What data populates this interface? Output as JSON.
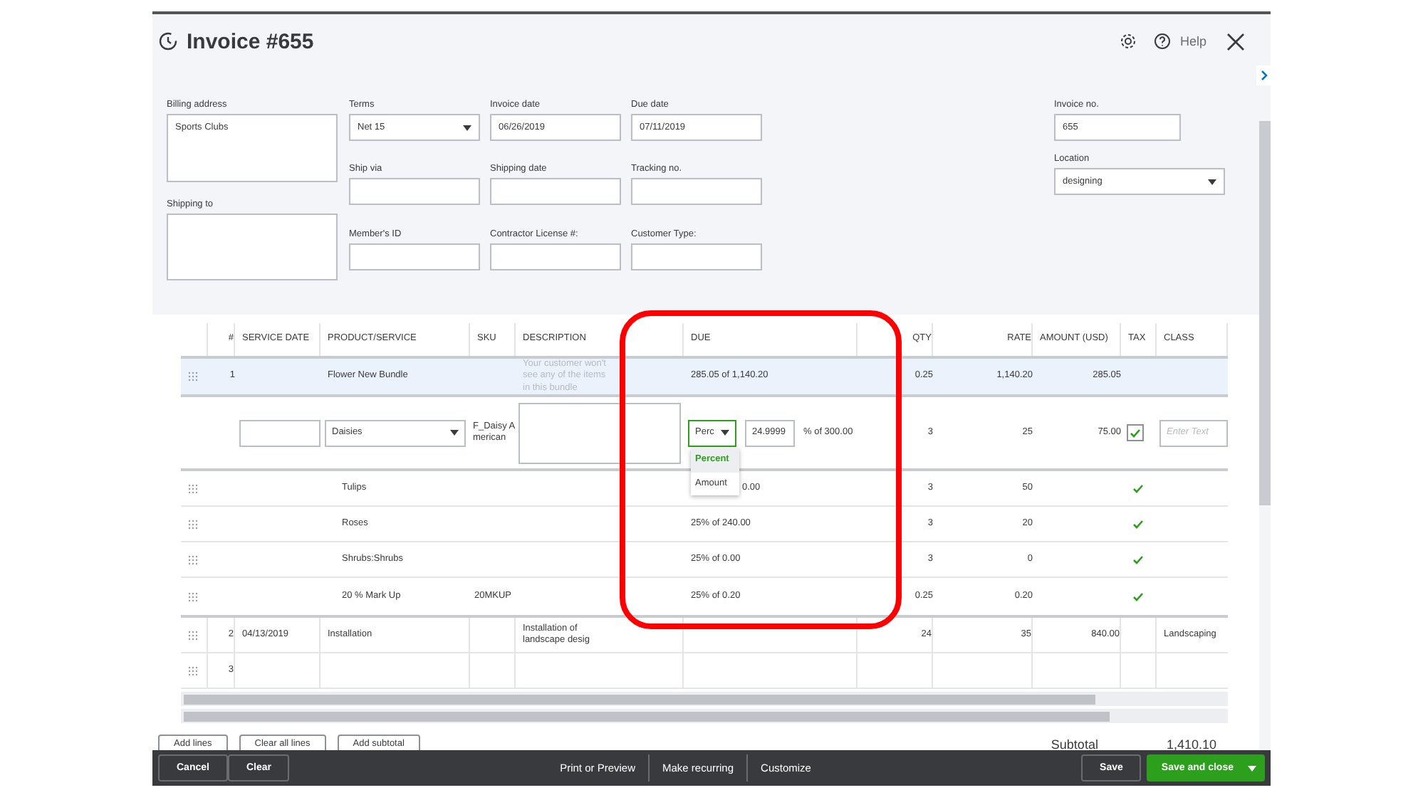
{
  "window": {
    "title": "Invoice #655",
    "help": "Help"
  },
  "form": {
    "billing_address": {
      "label": "Billing address",
      "value": "Sports Clubs"
    },
    "shipping_to": {
      "label": "Shipping to"
    },
    "fields": [
      {
        "label": "Terms",
        "value": "Net 15",
        "kind": "select"
      },
      {
        "label": "Invoice date",
        "value": "06/26/2019",
        "kind": "text"
      },
      {
        "label": "Due date",
        "value": "07/11/2019",
        "kind": "text"
      },
      {
        "label": "Ship via",
        "kind": "text"
      },
      {
        "label": "Shipping date",
        "kind": "text"
      },
      {
        "label": "Tracking no.",
        "kind": "text"
      },
      {
        "label": "Member's ID",
        "kind": "text"
      },
      {
        "label": "Contractor License #:",
        "kind": "text"
      },
      {
        "label": "Customer Type:",
        "kind": "text"
      }
    ],
    "right_fields": [
      {
        "label": "Invoice no.",
        "value": "655",
        "kind": "text"
      },
      {
        "label": "Location",
        "value": "designing",
        "kind": "select"
      }
    ]
  },
  "table": {
    "columns": [
      "#",
      "SERVICE DATE",
      "PRODUCT/SERVICE",
      "SKU",
      "DESCRIPTION",
      "DUE",
      "QTY",
      "RATE",
      "AMOUNT (USD)",
      "TAX",
      "CLASS"
    ],
    "rows": [
      {
        "kind": "bundle",
        "number": "1",
        "product": "Flower New Bundle",
        "description_hint": "Your customer won't see any of the items in this bundle",
        "due": "285.05 of 1,140.20",
        "qty": "0.25",
        "rate": "1,140.20",
        "amount": "285.05"
      },
      {
        "kind": "edit",
        "product": "Daisies",
        "sku": "F_Daisy American",
        "due_mode": "Perc",
        "due_value": "24.9999",
        "due_text": "% of 300.00",
        "qty": "3",
        "rate": "25",
        "amount": "75.00",
        "taxed": true,
        "class_placeholder": "Enter Text",
        "menu": [
          {
            "label": "Percent",
            "selected": true
          },
          {
            "label": "Amount",
            "selected": false
          }
        ]
      },
      {
        "kind": "item",
        "product": "Tulips",
        "due": "0.00",
        "qty": "3",
        "rate": "50",
        "taxed": true
      },
      {
        "kind": "item",
        "product": "Roses",
        "due": "25% of 240.00",
        "qty": "3",
        "rate": "20",
        "taxed": true
      },
      {
        "kind": "item",
        "product": "Shrubs:Shrubs",
        "due": "25% of 0.00",
        "qty": "3",
        "rate": "0",
        "taxed": true
      },
      {
        "kind": "item",
        "product": "20 % Mark Up",
        "sku": "20MKUP",
        "due": "25% of 0.20",
        "qty": "0.25",
        "rate": "0.20",
        "taxed": true
      },
      {
        "kind": "line",
        "number": "2",
        "service_date": "04/13/2019",
        "product": "Installation",
        "description": "Installation of landscape desig",
        "qty": "24",
        "rate": "35",
        "amount": "840.00",
        "class": "Landscaping"
      },
      {
        "kind": "line",
        "number": "3"
      }
    ]
  },
  "line_buttons": [
    "Add lines",
    "Clear all lines",
    "Add subtotal"
  ],
  "subtotal": {
    "label": "Subtotal",
    "value": "1,410.10"
  },
  "highlight": true,
  "footer": {
    "left": [
      "Cancel",
      "Clear"
    ],
    "center": [
      "Print or Preview",
      "Make recurring",
      "Customize"
    ],
    "save": "Save",
    "save_close": "Save and close"
  }
}
